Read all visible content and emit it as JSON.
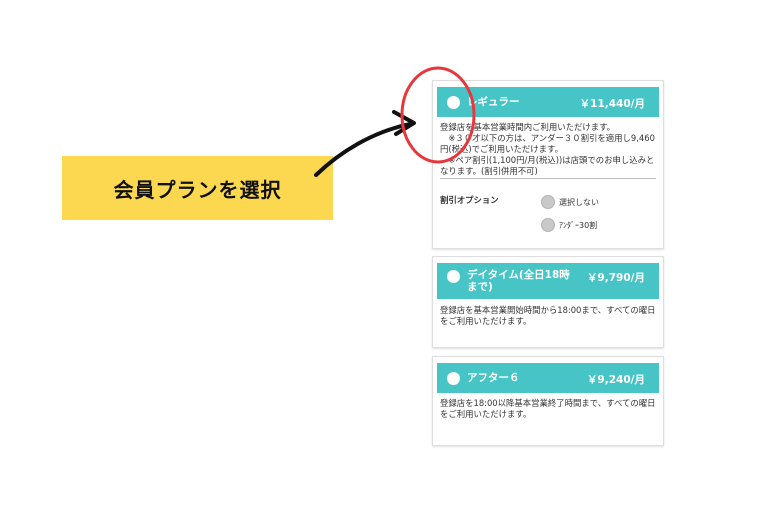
{
  "callout": {
    "label": "会員プランを選択"
  },
  "plans": [
    {
      "name": "レギュラー",
      "price": "￥11,440/月",
      "description_lines": [
        "登録店を基本営業時間内ご利用いただけます。",
        "　※３０才以下の方は、アンダー３０割引を適用し9,460",
        "円(税込)でご利用いただけます。",
        "　※ペア割引(1,100円/月(税込))は店頭でのお申し込みと",
        "なります。(割引併用不可)"
      ],
      "option_label": "割引オプション",
      "options": [
        "選択しない",
        "ｱﾝﾀﾞｰ30割"
      ]
    },
    {
      "name": "デイタイム(全日18時まで)",
      "price": "￥9,790/月",
      "description_lines": [
        "登録店を基本営業開始時間から18:00まで、すべての曜日",
        "をご利用いただけます。"
      ]
    },
    {
      "name": "アフター６",
      "price": "￥9,240/月",
      "description_lines": [
        "登録店を18:00以降基本営業終了時間まで、すべての曜日",
        "をご利用いただけます。"
      ]
    }
  ],
  "colors": {
    "accent": "#47c5c6",
    "callout_bg": "#fbd84f",
    "highlight_circle": "#e8373b",
    "arrow": "#111111"
  },
  "icons": {
    "arrow": "curved-arrow-icon",
    "highlight": "highlight-circle-icon"
  }
}
